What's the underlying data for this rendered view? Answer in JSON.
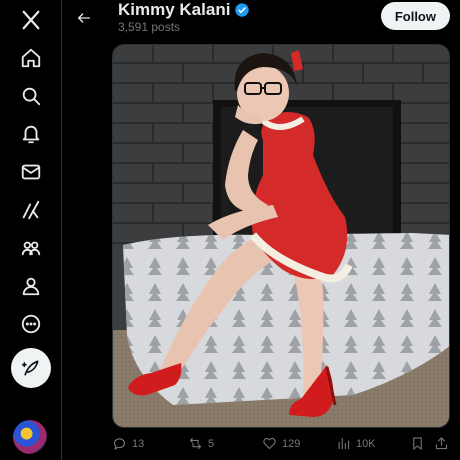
{
  "header": {
    "name": "Kimmy Kalani",
    "post_count": "3,591 posts",
    "follow_label": "Follow"
  },
  "nav": [
    {
      "name": "x-logo-icon"
    },
    {
      "name": "home-icon"
    },
    {
      "name": "search-icon"
    },
    {
      "name": "notifications-icon"
    },
    {
      "name": "messages-icon"
    },
    {
      "name": "grok-icon"
    },
    {
      "name": "communities-icon"
    },
    {
      "name": "profile-icon"
    },
    {
      "name": "more-icon"
    }
  ],
  "actions": {
    "replies": "13",
    "reposts": "5",
    "likes": "129",
    "views": "10K"
  },
  "colors": {
    "background": "#000000",
    "text": "#e7e9ea",
    "muted": "#71767b",
    "verified": "#1d9bf0",
    "dress": "#d42a2a"
  }
}
